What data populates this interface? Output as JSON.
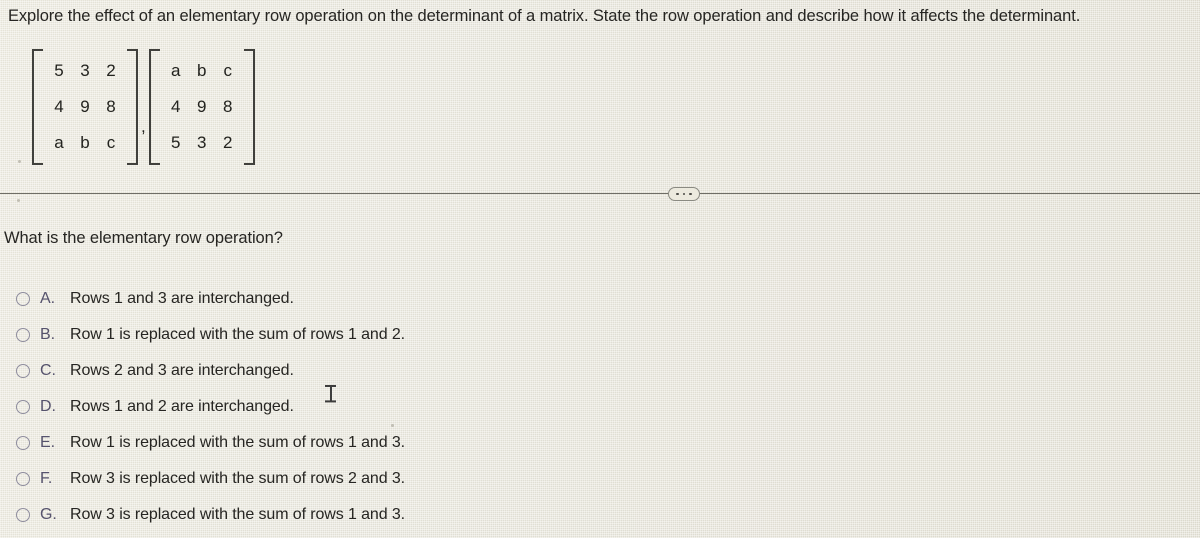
{
  "prompt": "Explore the effect of an elementary row operation on the determinant of a matrix. State the row operation and describe how it affects the determinant.",
  "matrices": {
    "separator": ",",
    "first": {
      "name": "original-matrix",
      "rows": [
        [
          "5",
          "3",
          "2"
        ],
        [
          "4",
          "9",
          "8"
        ],
        [
          "a",
          "b",
          "c"
        ]
      ]
    },
    "second": {
      "name": "transformed-matrix",
      "rows": [
        [
          "a",
          "b",
          "c"
        ],
        [
          "4",
          "9",
          "8"
        ],
        [
          "5",
          "3",
          "2"
        ]
      ]
    }
  },
  "divider": {
    "ellipsis_label": "..."
  },
  "question": "What is the elementary row operation?",
  "options": [
    {
      "letter": "A.",
      "text": "Rows 1 and 3 are interchanged.",
      "selected": false
    },
    {
      "letter": "B.",
      "text": "Row 1 is replaced with the sum of rows 1 and 2.",
      "selected": false
    },
    {
      "letter": "C.",
      "text": "Rows 2 and 3 are interchanged.",
      "selected": false
    },
    {
      "letter": "D.",
      "text": "Rows 1 and 2 are interchanged.",
      "selected": false
    },
    {
      "letter": "E.",
      "text": "Row 1 is replaced with the sum of rows 1 and 3.",
      "selected": false
    },
    {
      "letter": "F.",
      "text": "Row 3 is replaced with the sum of rows 2 and 3.",
      "selected": false
    },
    {
      "letter": "G.",
      "text": "Row 3 is replaced with the sum of rows 1 and 3.",
      "selected": false
    }
  ],
  "colors": {
    "background": "#e9e7dd",
    "text": "#262522",
    "option_letter": "#55526c",
    "radio_border": "#8f8d9e",
    "divider_line": "#6e6d66",
    "bracket": "#40403c"
  }
}
